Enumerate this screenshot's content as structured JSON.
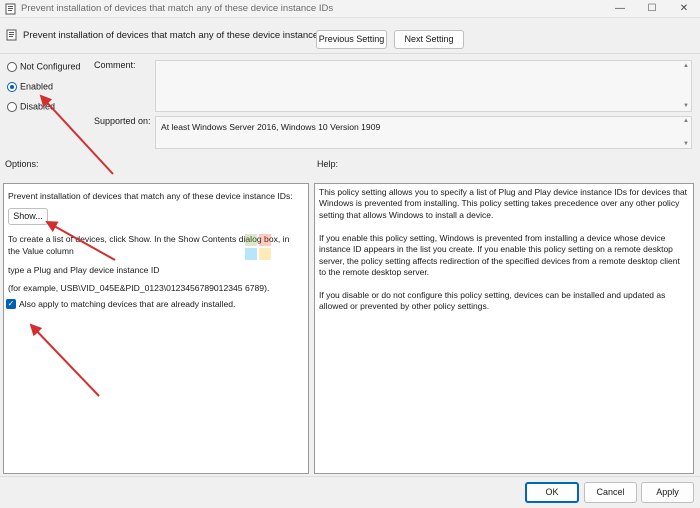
{
  "window": {
    "title": "Prevent installation of devices that match any of these device instance IDs",
    "minimize_glyph": "—",
    "maximize_glyph": "☐",
    "close_glyph": "✕"
  },
  "header": {
    "title": "Prevent installation of devices that match any of these device instance IDs",
    "previous_setting": "Previous Setting",
    "next_setting": "Next Setting"
  },
  "state": {
    "options": [
      {
        "label": "Not Configured",
        "selected": false
      },
      {
        "label": "Enabled",
        "selected": true
      },
      {
        "label": "Disabled",
        "selected": false
      }
    ]
  },
  "comment": {
    "label": "Comment:",
    "value": ""
  },
  "supported": {
    "label": "Supported on:",
    "value": "At least Windows Server 2016, Windows 10 Version 1909"
  },
  "options_panel": {
    "heading": "Options:",
    "line1": "Prevent installation of devices that match any of these device instance IDs:",
    "show_button": "Show...",
    "para1_a": "To create a list of devices, click Show. In the Show Contents dialog box, in",
    "para1_b": "the Value column",
    "para2": "type a Plug and Play device instance ID",
    "para3": "(for example, USB\\VID_045E&PID_0123\\0123456789012345 6789).",
    "checkbox_label": "Also apply to matching devices that are already installed.",
    "checkbox_checked": true
  },
  "help_panel": {
    "heading": "Help:",
    "p1": [
      "This policy setting allows you to specify a list of Plug and Play device instance IDs for devices that",
      "Windows is prevented from installing. This policy setting takes precedence over any other policy",
      "setting that allows Windows to install a device."
    ],
    "p2": [
      "If you enable this policy setting, Windows is prevented from installing a device whose device",
      "instance ID appears in the list you create. If you enable this policy setting on a remote desktop",
      "server, the policy setting affects redirection of the specified devices from a remote desktop client",
      "to the remote desktop server."
    ],
    "p3": [
      "If you disable or do not configure this policy setting, devices can be installed and updated as",
      "allowed or prevented by other policy settings."
    ]
  },
  "footer": {
    "ok": "OK",
    "cancel": "Cancel",
    "apply": "Apply"
  },
  "colors": {
    "accent": "#005fb8",
    "annotation_arrow": "#d32f2f"
  }
}
